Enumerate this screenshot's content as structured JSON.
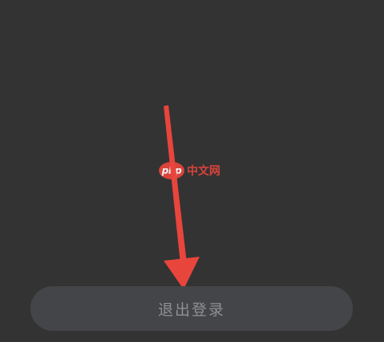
{
  "watermark": {
    "logo_text": "php",
    "site_name": "中文网"
  },
  "logout_button": {
    "label": "退出登录"
  },
  "colors": {
    "background": "#333333",
    "button_background": "#444548",
    "button_text": "#8f9094",
    "arrow": "#e8453c"
  },
  "icons": {
    "annotation": "arrow-down-icon"
  }
}
